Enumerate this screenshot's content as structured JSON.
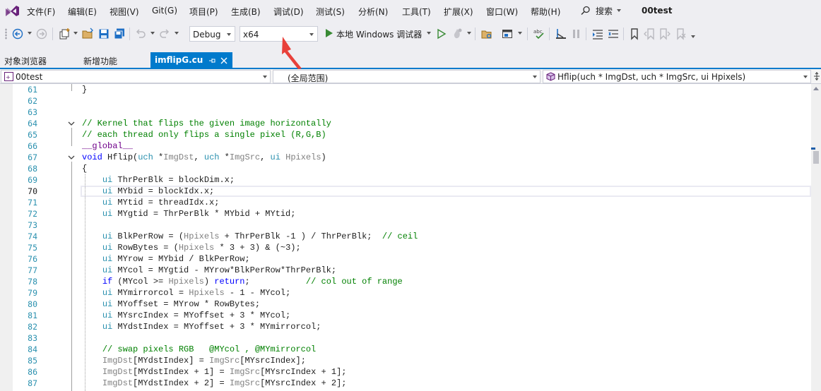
{
  "menu": {
    "items": [
      "文件(F)",
      "编辑(E)",
      "视图(V)",
      "Git(G)",
      "项目(P)",
      "生成(B)",
      "调试(D)",
      "测试(S)",
      "分析(N)",
      "工具(T)",
      "扩展(X)",
      "窗口(W)",
      "帮助(H)"
    ],
    "search_label": "搜索",
    "project_title": "00test"
  },
  "toolbar": {
    "configuration": "Debug",
    "platform": "x64",
    "run_label": "本地 Windows 调试器"
  },
  "tabs": [
    {
      "label": "对象浏览器",
      "active": false
    },
    {
      "label": "新增功能",
      "active": false
    },
    {
      "label": "imflipG.cu",
      "active": true
    }
  ],
  "navbar": {
    "project": "00test",
    "scope": "(全局范围)",
    "member": "Hflip(uch * ImgDst, uch * ImgSrc, ui Hpixels)"
  },
  "editor": {
    "current_line": 70,
    "lines": [
      {
        "n": 61,
        "text": "}"
      },
      {
        "n": 62,
        "text": ""
      },
      {
        "n": 63,
        "text": ""
      },
      {
        "n": 64,
        "text": "// Kernel that flips the given image horizontally"
      },
      {
        "n": 65,
        "text": "// each thread only flips a single pixel (R,G,B)"
      },
      {
        "n": 66,
        "text": "__global__"
      },
      {
        "n": 67,
        "text": "void Hflip(uch *ImgDst, uch *ImgSrc, ui Hpixels)"
      },
      {
        "n": 68,
        "text": "{"
      },
      {
        "n": 69,
        "text": "    ui ThrPerBlk = blockDim.x;"
      },
      {
        "n": 70,
        "text": "    ui MYbid = blockIdx.x;"
      },
      {
        "n": 71,
        "text": "    ui MYtid = threadIdx.x;"
      },
      {
        "n": 72,
        "text": "    ui MYgtid = ThrPerBlk * MYbid + MYtid;"
      },
      {
        "n": 73,
        "text": ""
      },
      {
        "n": 74,
        "text": "    ui BlkPerRow = (Hpixels + ThrPerBlk -1 ) / ThrPerBlk;  // ceil"
      },
      {
        "n": 75,
        "text": "    ui RowBytes = (Hpixels * 3 + 3) & (~3);"
      },
      {
        "n": 76,
        "text": "    ui MYrow = MYbid / BlkPerRow;"
      },
      {
        "n": 77,
        "text": "    ui MYcol = MYgtid - MYrow*BlkPerRow*ThrPerBlk;"
      },
      {
        "n": 78,
        "text": "    if (MYcol >= Hpixels) return;           // col out of range"
      },
      {
        "n": 79,
        "text": "    ui MYmirrorcol = Hpixels - 1 - MYcol;"
      },
      {
        "n": 80,
        "text": "    ui MYoffset = MYrow * RowBytes;"
      },
      {
        "n": 81,
        "text": "    ui MYsrcIndex = MYoffset + 3 * MYcol;"
      },
      {
        "n": 82,
        "text": "    ui MYdstIndex = MYoffset + 3 * MYmirrorcol;"
      },
      {
        "n": 83,
        "text": ""
      },
      {
        "n": 84,
        "text": "    // swap pixels RGB   @MYcol , @MYmirrorcol"
      },
      {
        "n": 85,
        "text": "    ImgDst[MYdstIndex] = ImgSrc[MYsrcIndex];"
      },
      {
        "n": 86,
        "text": "    ImgDst[MYdstIndex + 1] = ImgSrc[MYsrcIndex + 1];"
      },
      {
        "n": 87,
        "text": "    ImgDst[MYdstIndex + 2] = ImgSrc[MYsrcIndex + 2];"
      }
    ]
  },
  "colors": {
    "keyword": "#0000ff",
    "type": "#2b91af",
    "comment": "#008000",
    "macro": "#6f008a",
    "param": "#808080",
    "accent": "#007acc",
    "callout": "#e8403a"
  }
}
